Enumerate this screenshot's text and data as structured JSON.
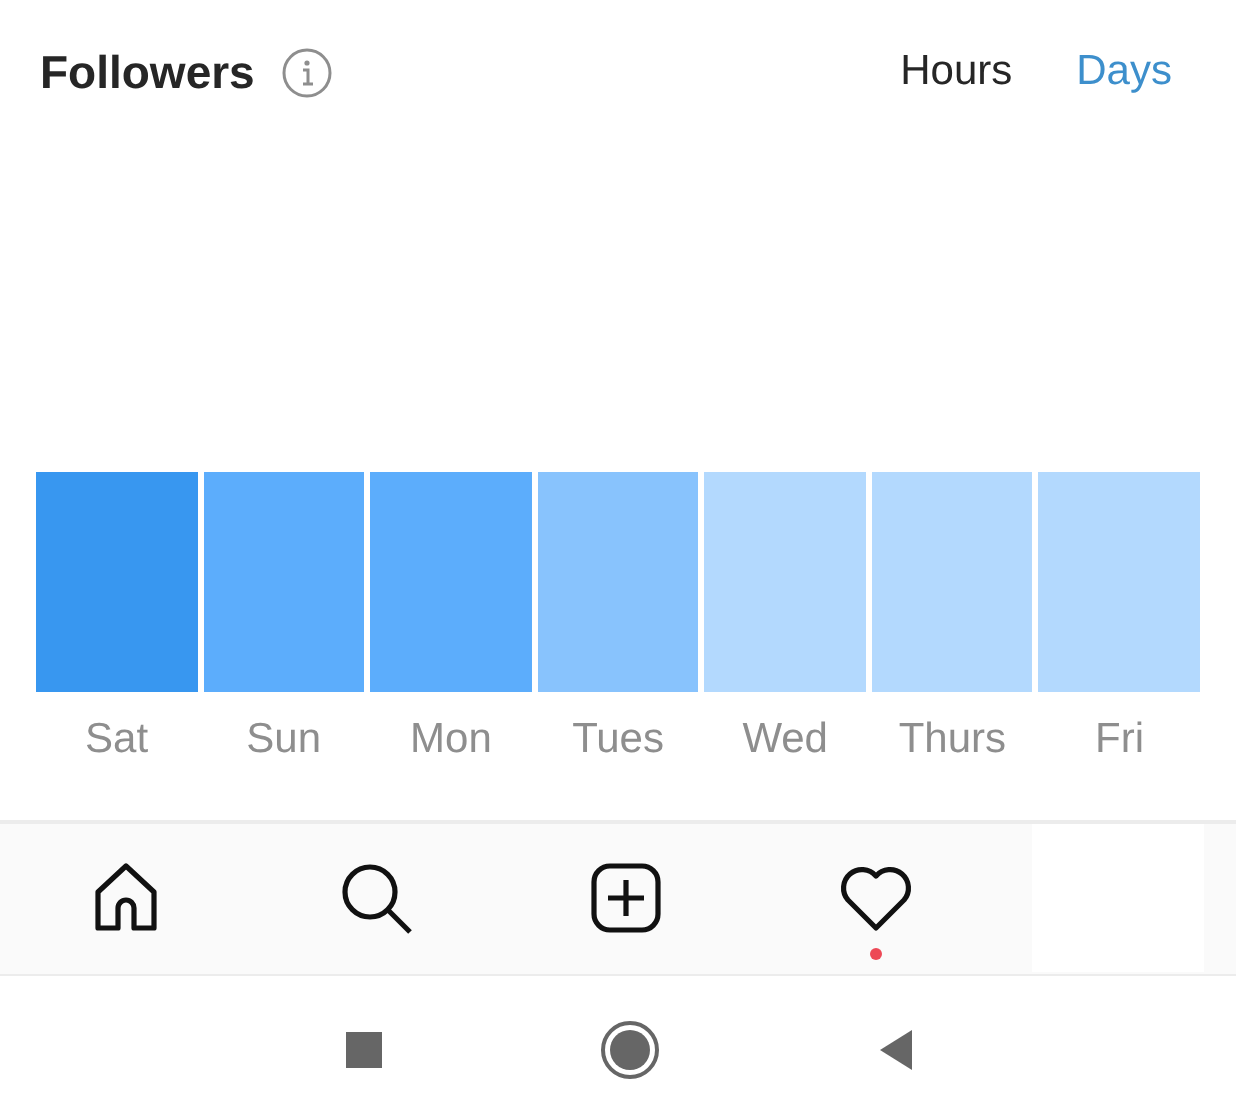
{
  "header": {
    "title": "Followers",
    "tabs": [
      {
        "label": "Hours",
        "selected": false
      },
      {
        "label": "Days",
        "selected": true
      }
    ]
  },
  "days": [
    {
      "label": "Sat",
      "color": "#3897f0"
    },
    {
      "label": "Sun",
      "color": "#5cadfc"
    },
    {
      "label": "Mon",
      "color": "#5cadfc"
    },
    {
      "label": "Tues",
      "color": "#88c3fd"
    },
    {
      "label": "Wed",
      "color": "#b3d9fe"
    },
    {
      "label": "Thurs",
      "color": "#b3d9fe"
    },
    {
      "label": "Fri",
      "color": "#b3d9fe"
    }
  ],
  "nav": [
    {
      "kind": "home",
      "badge": false
    },
    {
      "kind": "search",
      "badge": false
    },
    {
      "kind": "add",
      "badge": false
    },
    {
      "kind": "activity",
      "badge": true
    }
  ]
}
